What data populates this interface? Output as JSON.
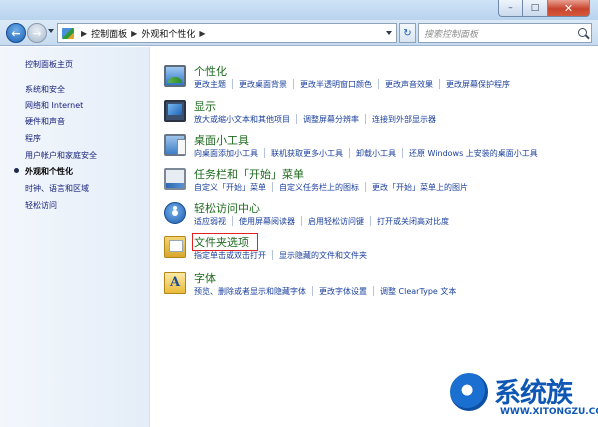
{
  "window": {
    "controls": {
      "minimize": "–",
      "maximize": "□",
      "close": "✕"
    }
  },
  "navigation": {
    "back_icon": "←",
    "forward_icon": "→",
    "breadcrumbs": [
      "控制面板",
      "外观和个性化"
    ],
    "refresh_icon": "↻",
    "search_placeholder": "搜索控制面板"
  },
  "sidebar": {
    "items": [
      {
        "label": "控制面板主页"
      },
      {
        "label": "系统和安全"
      },
      {
        "label": "网络和 Internet"
      },
      {
        "label": "硬件和声音"
      },
      {
        "label": "程序"
      },
      {
        "label": "用户帐户和家庭安全"
      },
      {
        "label": "外观和个性化",
        "current": true
      },
      {
        "label": "时钟、语言和区域"
      },
      {
        "label": "轻松访问"
      }
    ]
  },
  "categories": [
    {
      "title": "个性化",
      "icon": "personalization-icon",
      "links": [
        "更改主题",
        "更改桌面背景",
        "更改半透明窗口颜色",
        "更改声音效果",
        "更改屏幕保护程序"
      ]
    },
    {
      "title": "显示",
      "icon": "display-icon",
      "links": [
        "放大或缩小文本和其他项目",
        "调整屏幕分辨率",
        "连接到外部显示器"
      ]
    },
    {
      "title": "桌面小工具",
      "icon": "gadgets-icon",
      "links": [
        "向桌面添加小工具",
        "联机获取更多小工具",
        "卸载小工具",
        "还原 Windows 上安装的桌面小工具"
      ]
    },
    {
      "title": "任务栏和「开始」菜单",
      "icon": "taskbar-icon",
      "links": [
        "自定义「开始」菜单",
        "自定义任务栏上的图标",
        "更改「开始」菜单上的图片"
      ]
    },
    {
      "title": "轻松访问中心",
      "icon": "ease-of-access-icon",
      "links": [
        "适应弱视",
        "使用屏幕阅读器",
        "启用轻松访问键",
        "打开或关闭高对比度"
      ]
    },
    {
      "title": "文件夹选项",
      "icon": "folder-options-icon",
      "highlighted": true,
      "links": [
        "指定单击或双击打开",
        "显示隐藏的文件和文件夹"
      ]
    },
    {
      "title": "字体",
      "icon": "fonts-icon",
      "links": [
        "预览、删除或者显示和隐藏字体",
        "更改字体设置",
        "调整 ClearType 文本"
      ]
    }
  ],
  "watermark": {
    "brand": "系统族",
    "url": "WWW.XITONGZU.COM"
  },
  "colors": {
    "link": "#1a3f9c",
    "category_title": "#1e6a1e",
    "highlight": "#e22222"
  }
}
